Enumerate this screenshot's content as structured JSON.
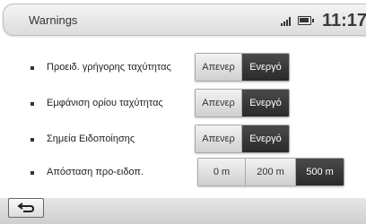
{
  "header": {
    "title": "Warnings",
    "clock": "11:17"
  },
  "settings": [
    {
      "label": "Προειδ. γρήγορης ταχύτητας",
      "options": [
        "Απενερ",
        "Ενεργό"
      ],
      "selected": "Ενεργό"
    },
    {
      "label": "Εμφάνιση ορίου ταχύτητας",
      "options": [
        "Απενερ",
        "Ενεργό"
      ],
      "selected": "Ενεργό"
    },
    {
      "label": "Σημεία Ειδοποίησης",
      "options": [
        "Απενερ",
        "Ενεργό"
      ],
      "selected": "Ενεργό"
    },
    {
      "label": "Απόσταση προ-ειδοπ.",
      "options": [
        "0 m",
        "200 m",
        "500 m"
      ],
      "selected": "500 m"
    }
  ],
  "icons": {
    "signal": "signal-strength-icon",
    "battery": "battery-icon",
    "back": "back-arrow-icon"
  }
}
